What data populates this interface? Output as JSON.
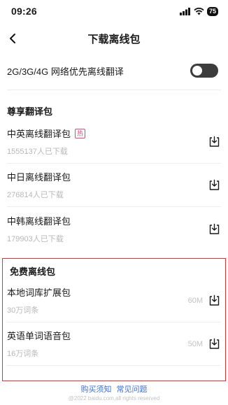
{
  "status_bar": {
    "time": "09:26",
    "battery": "75"
  },
  "header": {
    "title": "下载离线包"
  },
  "network_toggle": {
    "label": "2G/3G/4G 网络优先离线翻译",
    "enabled": true
  },
  "premium": {
    "title": "尊享翻译包",
    "items": [
      {
        "name": "中英离线翻译包",
        "badge": "热",
        "downloads": "1555137人已下载"
      },
      {
        "name": "中日离线翻译包",
        "downloads": "276814人已下载"
      },
      {
        "name": "中韩离线翻译包",
        "downloads": "179903人已下载"
      }
    ]
  },
  "free": {
    "title": "免费离线包",
    "items": [
      {
        "name": "本地词库扩展包",
        "words": "30万词条",
        "size": "60M"
      },
      {
        "name": "英语单词语音包",
        "words": "16万词条",
        "size": "50M"
      }
    ]
  },
  "footer": {
    "links": [
      "购买须知",
      "常见问题"
    ],
    "copyright": "@2022 baidu.com,all rights reserved"
  },
  "colors": {
    "accent_blue": "#3b6fe0",
    "hot_pink": "#e0467d",
    "highlight_red": "#e23030"
  }
}
